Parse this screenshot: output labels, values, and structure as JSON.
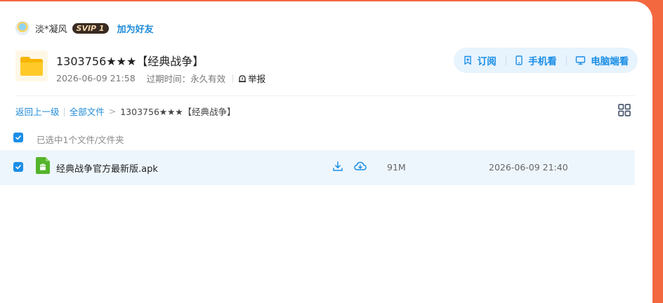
{
  "owner": {
    "name": "淡*凝风",
    "badge": "SVIP 1",
    "add_friend": "加为好友"
  },
  "share": {
    "title": "1303756★★★【经典战争】",
    "date": "2026-06-09 21:58",
    "expiry": "过期时间：永久有效",
    "report": "举报"
  },
  "actions": {
    "subscribe": "订阅",
    "phone": "手机看",
    "pc": "电脑端看"
  },
  "breadcrumb": {
    "back": "返回上一级",
    "all": "全部文件",
    "current": "1303756★★★【经典战争】"
  },
  "selection": {
    "text": "已选中1个文件/文件夹"
  },
  "files": [
    {
      "name": "经典战争官方最新版.apk",
      "size": "91M",
      "date": "2026-06-09 21:40",
      "checked": true
    }
  ],
  "colors": {
    "accent": "#1a8ee6",
    "page_bg": "#f4683f",
    "row_highlight": "#eef6fd"
  },
  "icons": [
    "avatar",
    "folder-icon",
    "report-icon",
    "subscribe-icon",
    "phone-icon",
    "pc-icon",
    "grid-view-icon",
    "android-apk-icon",
    "download-icon",
    "cloud-save-icon"
  ]
}
